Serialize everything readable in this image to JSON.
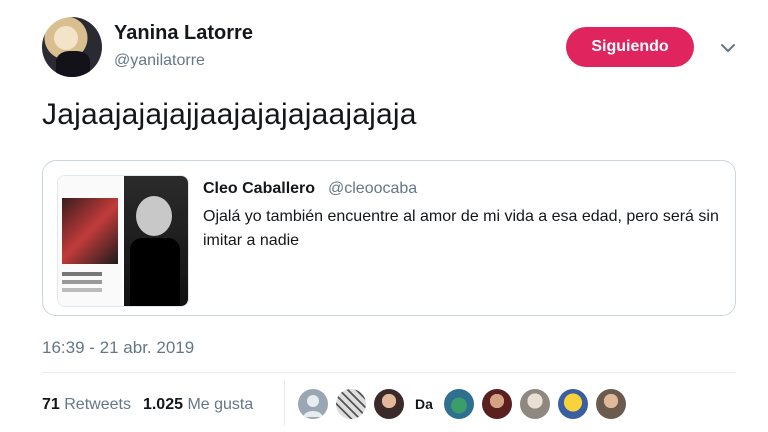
{
  "user": {
    "display_name": "Yanina Latorre",
    "handle": "@yanilatorre",
    "follow_label": "Siguiendo"
  },
  "tweet": {
    "text": "Jajaajajajajjaajajajajaajajaja",
    "timestamp": "16:39 - 21 abr. 2019"
  },
  "quoted": {
    "name": "Cleo Caballero",
    "handle": "@cleoocaba",
    "text": "Ojalá yo también encuentre al amor de mi vida a esa edad, pero será sin imitar a nadie"
  },
  "stats": {
    "retweets_count": "71",
    "retweets_label": "Retweets",
    "likes_count": "1.025",
    "likes_label": "Me gusta"
  },
  "likers": {
    "text_avatar": "Da",
    "avatar_colors": [
      "#9aa7b3",
      "#d9d9d9",
      "#c89b7b",
      "#2f6f8f",
      "#7a3b3b",
      "#b8b2aa",
      "#f2c12e",
      "#caa58c"
    ]
  },
  "colors": {
    "follow_button": "#e0245e",
    "secondary_text": "#657786",
    "border": "#ccd6dd"
  }
}
